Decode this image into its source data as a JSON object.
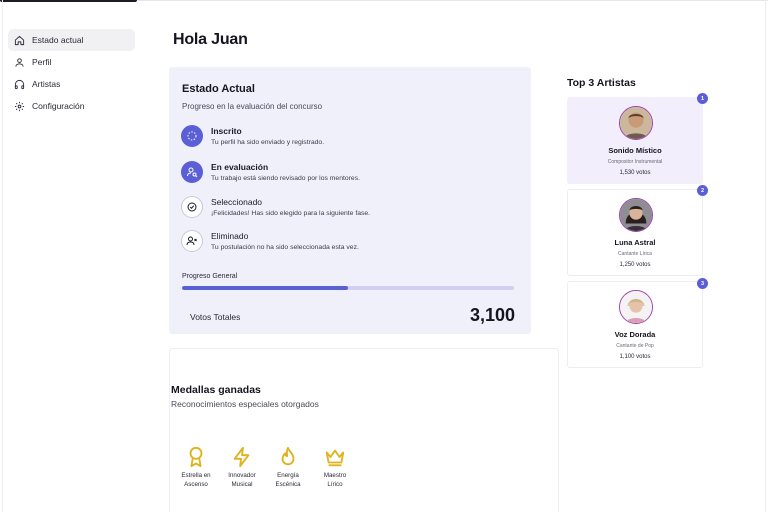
{
  "sidebar": {
    "items": [
      {
        "label": "Estado actual",
        "icon": "home-icon",
        "active": true
      },
      {
        "label": "Perfil",
        "icon": "user-icon",
        "active": false
      },
      {
        "label": "Artistas",
        "icon": "headphones-icon",
        "active": false
      },
      {
        "label": "Configuración",
        "icon": "gear-icon",
        "active": false
      }
    ]
  },
  "header": {
    "greeting": "Hola Juan"
  },
  "status": {
    "title": "Estado Actual",
    "subtitle": "Progreso en la evaluación del concurso",
    "steps": [
      {
        "title": "Inscrito",
        "desc": "Tu perfil ha sido enviado y registrado.",
        "icon": "dashed-circle-icon",
        "state": "done"
      },
      {
        "title": "En evaluación",
        "desc": "Tu trabajo está siendo revisado por los mentores.",
        "icon": "user-search-icon",
        "state": "current"
      },
      {
        "title": "Seleccionado",
        "desc": "¡Felicidades! Has sido elegido para la siguiente fase.",
        "icon": "check-circle-icon",
        "state": "pending"
      },
      {
        "title": "Eliminado",
        "desc": "Tu postulación no ha sido seleccionada esta vez.",
        "icon": "user-x-icon",
        "state": "pending"
      }
    ],
    "progress_label": "Progreso General",
    "progress_fraction": 0.5,
    "votes_label": "Votos Totales",
    "votes_value": "3,100"
  },
  "medals": {
    "title": "Medallas ganadas",
    "subtitle": "Reconocimientos especiales otorgados",
    "items": [
      {
        "line1": "Estrella en",
        "line2": "Ascenso",
        "icon": "award-icon"
      },
      {
        "line1": "Innovador",
        "line2": "Musical",
        "icon": "lightning-icon"
      },
      {
        "line1": "Energía",
        "line2": "Escénica",
        "icon": "flame-icon"
      },
      {
        "line1": "Maestro",
        "line2": "Lírico",
        "icon": "crown-icon"
      }
    ]
  },
  "top_artists": {
    "title": "Top 3 Artistas",
    "items": [
      {
        "rank": "1",
        "name": "Sonido Místico",
        "role": "Compositor Instrumental",
        "votes": "1,530 votos"
      },
      {
        "rank": "2",
        "name": "Luna Astral",
        "role": "Cantante Lírica",
        "votes": "1,250 votos"
      },
      {
        "rank": "3",
        "name": "Voz Dorada",
        "role": "Cantante de Pop",
        "votes": "1,100 votos"
      }
    ]
  },
  "colors": {
    "accent": "#5b5fd6",
    "card_bg": "#f0f0fb",
    "medal": "#e0b21c",
    "avatar_ring": "#9b3fb0"
  }
}
